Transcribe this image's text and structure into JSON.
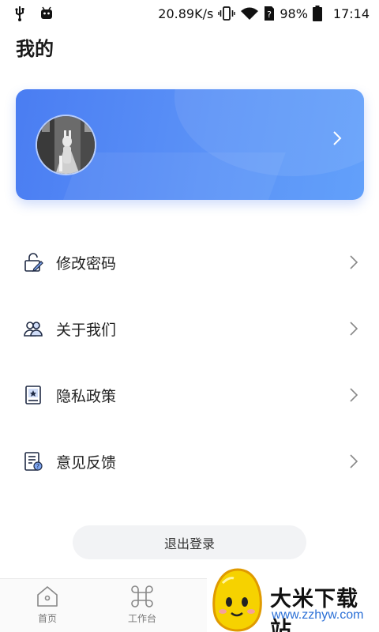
{
  "status_bar": {
    "network_speed": "20.89K/s",
    "battery": "98%",
    "time": "17:14",
    "icons": [
      "usb-icon",
      "android-icon",
      "vibrate-icon",
      "wifi-icon",
      "no-sim-icon",
      "battery-icon"
    ]
  },
  "page": {
    "title": "我的"
  },
  "profile_card": {
    "accent": "#4a7df2"
  },
  "menu": {
    "items": [
      {
        "label": "修改密码",
        "icon": "password-edit-icon"
      },
      {
        "label": "关于我们",
        "icon": "people-icon"
      },
      {
        "label": "隐私政策",
        "icon": "privacy-doc-icon"
      },
      {
        "label": "意见反馈",
        "icon": "feedback-icon"
      }
    ]
  },
  "logout": {
    "label": "退出登录"
  },
  "bottom_nav": {
    "tabs": [
      {
        "label": "首页",
        "icon": "home-icon"
      },
      {
        "label": "工作台",
        "icon": "command-icon"
      }
    ]
  },
  "watermark": {
    "text": "大米下载站",
    "url": "www.zzhyw.com"
  }
}
